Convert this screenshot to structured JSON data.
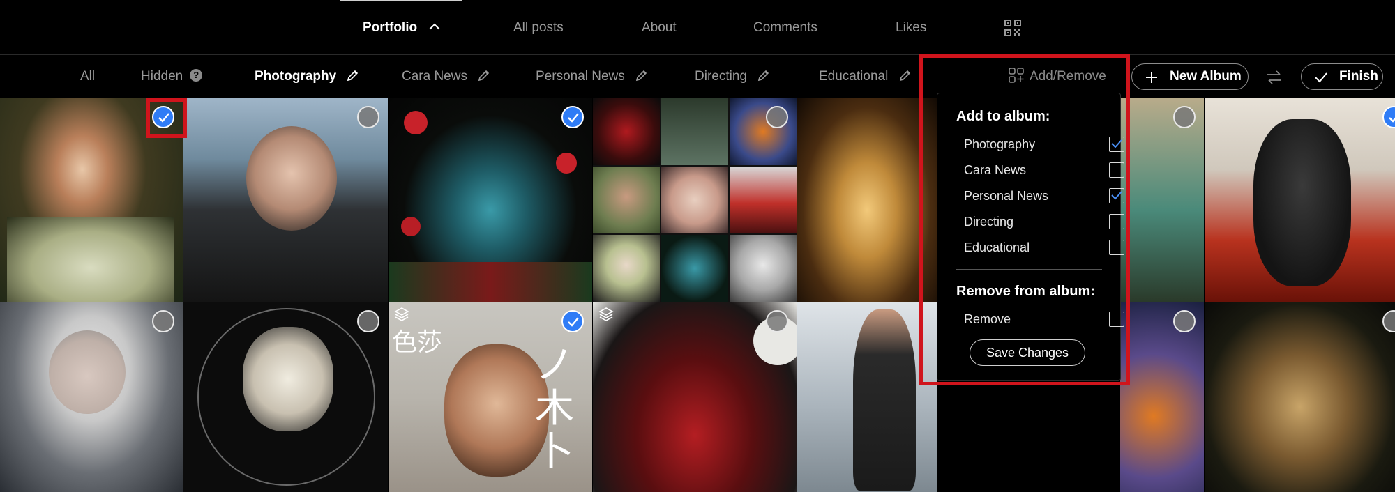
{
  "nav": {
    "tabs": [
      {
        "label": "Portfolio",
        "active": true
      },
      {
        "label": "All posts"
      },
      {
        "label": "About"
      },
      {
        "label": "Comments"
      },
      {
        "label": "Likes"
      }
    ],
    "icons": {
      "chevron": "chevron-up-icon",
      "qr": "qr-code-icon"
    }
  },
  "albums": {
    "items": [
      {
        "label": "All"
      },
      {
        "label": "Hidden",
        "badge": "?"
      },
      {
        "label": "Photography",
        "active": true
      },
      {
        "label": "Cara News"
      },
      {
        "label": "Personal News"
      },
      {
        "label": "Directing"
      },
      {
        "label": "Educational"
      }
    ],
    "add_remove": "Add/Remove",
    "new_album": "New Album",
    "finish": "Finish"
  },
  "grid": {
    "tiles": [
      {
        "selected": true
      },
      {
        "selected": false
      },
      {
        "selected": true
      },
      {
        "selected": false
      },
      {
        "selected": false
      },
      {
        "selected": false
      },
      {
        "selected": true
      },
      {
        "selected": false
      },
      {
        "selected": false
      },
      {
        "selected": true
      },
      {
        "selected": false
      },
      {
        "selected": false
      },
      {
        "selected": false
      },
      {
        "selected": false
      }
    ],
    "overlay_text": {
      "cn1": "色莎",
      "cn2": "ノ木卜"
    }
  },
  "dropdown": {
    "add_heading": "Add to album:",
    "add_options": [
      {
        "label": "Photography",
        "checked": true
      },
      {
        "label": "Cara News",
        "checked": false
      },
      {
        "label": "Personal News",
        "checked": true
      },
      {
        "label": "Directing",
        "checked": false
      },
      {
        "label": "Educational",
        "checked": false
      }
    ],
    "remove_heading": "Remove from album:",
    "remove_options": [
      {
        "label": "Remove",
        "checked": false
      }
    ],
    "save": "Save Changes"
  },
  "colors": {
    "accent": "#2f7cf6",
    "highlight": "#d0141c",
    "background": "#000000"
  }
}
